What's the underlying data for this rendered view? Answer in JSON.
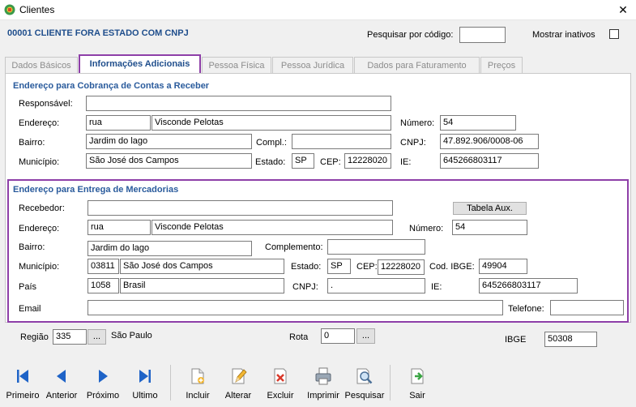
{
  "window": {
    "title": "Clientes",
    "close_symbol": "✕"
  },
  "header": {
    "record": "00001 CLIENTE FORA ESTADO COM CNPJ",
    "search_label": "Pesquisar por código:",
    "search_value": "",
    "show_inactive_label": "Mostrar inativos"
  },
  "tabs": [
    "Dados Básicos",
    "Informações Adicionais",
    "Pessoa Física",
    "Pessoa Jurídica",
    "Dados para Faturamento",
    "Preços"
  ],
  "billing": {
    "title": "Endereço para Cobrança de Contas a Receber",
    "responsavel_label": "Responsável:",
    "responsavel": "",
    "endereco_label": "Endereço:",
    "tipo": "rua",
    "logradouro": "Visconde Pelotas",
    "numero_label": "Número:",
    "numero": "54",
    "bairro_label": "Bairro:",
    "bairro": "Jardim do lago",
    "compl_label": "Compl.:",
    "compl": "",
    "cnpj_label": "CNPJ:",
    "cnpj": "47.892.906/0008-06",
    "municipio_label": "Município:",
    "municipio": "São José dos Campos",
    "estado_label": "Estado:",
    "estado": "SP",
    "cep_label": "CEP:",
    "cep": "12228020",
    "ie_label": "IE:",
    "ie": "645266803117"
  },
  "delivery": {
    "title": "Endereço para Entrega de Mercadorias",
    "recebedor_label": "Recebedor:",
    "recebedor": "",
    "tabela_aux_label": "Tabela Aux.",
    "endereco_label": "Endereço:",
    "tipo": "rua",
    "logradouro": "Visconde Pelotas",
    "numero_label": "Número:",
    "numero": "54",
    "bairro_label": "Bairro:",
    "bairro": "Jardim do lago",
    "complemento_label": "Complemento:",
    "complemento": "",
    "municipio_label": "Município:",
    "municipio_cod": "03811",
    "municipio": "São José dos Campos",
    "estado_label": "Estado:",
    "estado": "SP",
    "cep_label": "CEP:",
    "cep": "12228020",
    "cod_ibge_label": "Cod. IBGE:",
    "cod_ibge": "49904",
    "pais_label": "País",
    "pais_cod": "1058",
    "pais": "Brasil",
    "cnpj_label": "CNPJ:",
    "cnpj": ".",
    "ie_label": "IE:",
    "ie": "645266803117",
    "email_label": "Email",
    "email": "",
    "telefone_label": "Telefone:",
    "telefone": ""
  },
  "footer": {
    "regiao_label": "Região",
    "regiao_cod": "335",
    "regiao_nome": "São Paulo",
    "rota_label": "Rota",
    "rota": "0",
    "ibge_label": "IBGE",
    "ibge": "50308",
    "lookup_label": "..."
  },
  "toolbar": {
    "primeiro": "Primeiro",
    "anterior": "Anterior",
    "proximo": "Próximo",
    "ultimo": "Ultimo",
    "incluir": "Incluir",
    "alterar": "Alterar",
    "excluir": "Excluir",
    "imprimir": "Imprimir",
    "pesquisar": "Pesquisar",
    "sair": "Sair"
  },
  "colors": {
    "nav_blue": "#1e63c7",
    "title_blue": "#1f4e8c",
    "highlight": "#8e3fa8",
    "delete_red": "#d93a2b",
    "exit_green": "#3aa544"
  }
}
